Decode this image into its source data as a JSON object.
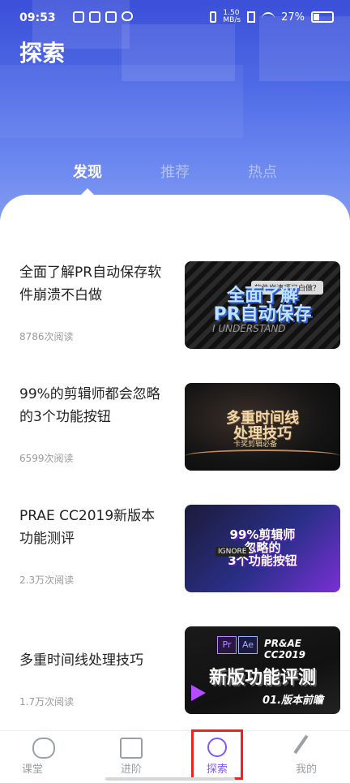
{
  "status": {
    "time": "09:53",
    "net_speed": "1.50\nMB/s",
    "battery": "27%"
  },
  "header": {
    "title": "探索"
  },
  "tabs": [
    {
      "label": "发现",
      "active": true
    },
    {
      "label": "推荐",
      "active": false
    },
    {
      "label": "热点",
      "active": false
    }
  ],
  "articles": [
    {
      "title": "全面了解PR自动保存软件崩溃不白做",
      "reads": "8786次阅读",
      "thumb_text": "全面了解\nPR自动保存",
      "thumb_badge": "软件崩溃项目白做？"
    },
    {
      "title": "99%的剪辑师都会忽略的3个功能按钮",
      "reads": "6599次阅读",
      "thumb_text": "多重时间线\n处理技巧",
      "thumb_badge": "卡奖剪辑必备"
    },
    {
      "title": "PRAE CC2019新版本功能测评",
      "reads": "2.3万次阅读",
      "thumb_text": "99%剪辑师\n忽略的\n3个功能按钮",
      "thumb_badge": "IGNORE"
    },
    {
      "title": "多重时间线处理技巧",
      "reads": "1.7万次阅读",
      "thumb_text": "新版功能评测",
      "thumb_badge": "PR&AE CC2019"
    }
  ],
  "thumb_extras": {
    "t1_sub": "I UNDERSTAND",
    "t4_tag": "01.版本前瞻",
    "t4_pr": "Pr",
    "t4_ae": "Ae"
  },
  "nav": [
    {
      "label": "课堂",
      "icon": "classroom-icon",
      "active": false
    },
    {
      "label": "进阶",
      "icon": "advance-icon",
      "active": false
    },
    {
      "label": "探索",
      "icon": "explore-icon",
      "active": true
    },
    {
      "label": "我的",
      "icon": "wrench-icon",
      "active": false
    }
  ],
  "colors": {
    "accent": "#7e57ff",
    "highlight": "#e22",
    "hero": "#4f6ae6"
  }
}
